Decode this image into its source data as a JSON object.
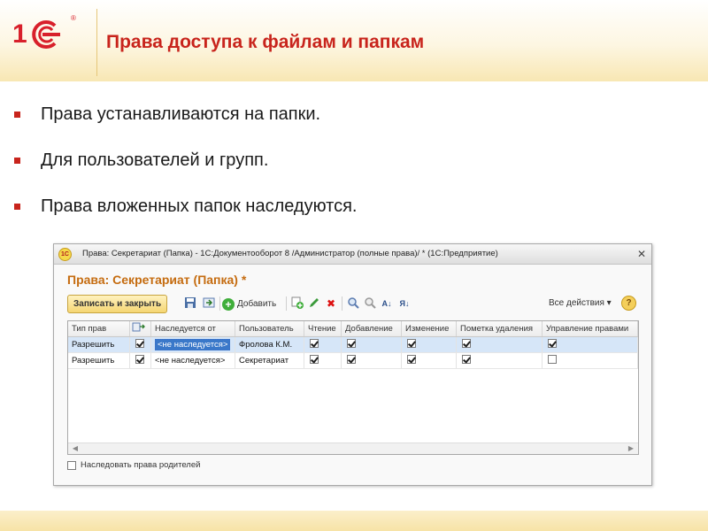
{
  "slide": {
    "title": "Права доступа к файлам и папкам",
    "bullets": [
      "Права устанавливаются  на папки.",
      "Для пользователей  и групп.",
      "Права вложенных  папок наследуются."
    ]
  },
  "window": {
    "title": "Права: Секретариат (Папка) - 1С:Документооборот 8 /Администратор (полные права)/ *  (1С:Предприятие)",
    "form_title": "Права: Секретариат (Папка) *",
    "toolbar": {
      "save_close": "Записать и закрыть",
      "add": "Добавить",
      "all_actions": "Все действия ▾",
      "help": "?"
    },
    "grid": {
      "columns": [
        "Тип прав",
        "",
        "Наследуется от",
        "Пользователь",
        "Чтение",
        "Добавление",
        "Изменение",
        "Пометка удаления",
        "Управление правами"
      ],
      "rows": [
        {
          "type": "Разрешить",
          "flag": true,
          "inherited_from": "<не наследуется>",
          "user": "Фролова К.М.",
          "read": true,
          "add": true,
          "edit": true,
          "delete_mark": true,
          "manage": true
        },
        {
          "type": "Разрешить",
          "flag": true,
          "inherited_from": "<не наследуется>",
          "user": "Секретариат",
          "read": true,
          "add": true,
          "edit": true,
          "delete_mark": true,
          "manage": false
        }
      ]
    },
    "inherit_parent_label": "Наследовать права родителей",
    "inherit_parent_checked": false
  },
  "colors": {
    "title_red": "#c8241c",
    "form_title_orange": "#c56c10",
    "selection": "#d6e6f8"
  }
}
